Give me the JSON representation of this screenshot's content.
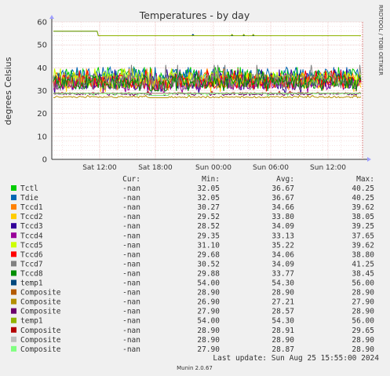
{
  "chart_data": {
    "type": "line",
    "title": "Temperatures - by day",
    "ylabel": "degrees Celsius",
    "side_label": "RRDTOOL / TOBI OETIKER",
    "ylim": [
      0,
      60
    ],
    "yticks": [
      0,
      10,
      20,
      30,
      40,
      50,
      60
    ],
    "xticks": [
      "Sat 12:00",
      "Sat 18:00",
      "Sun 00:00",
      "Sun 06:00",
      "Sun 12:00"
    ],
    "grid": true,
    "legend_header": {
      "cur": "Cur:",
      "min": "Min:",
      "avg": "Avg:",
      "max": "Max:"
    },
    "series": [
      {
        "name": "Tctl",
        "color": "#00cc00",
        "cur": "-nan",
        "min": "32.05",
        "avg": "36.67",
        "max": "40.25"
      },
      {
        "name": "Tdie",
        "color": "#0066b3",
        "cur": "-nan",
        "min": "32.05",
        "avg": "36.67",
        "max": "40.25"
      },
      {
        "name": "Tccd1",
        "color": "#ff8000",
        "cur": "-nan",
        "min": "30.27",
        "avg": "34.66",
        "max": "39.62"
      },
      {
        "name": "Tccd2",
        "color": "#ffcc00",
        "cur": "-nan",
        "min": "29.52",
        "avg": "33.80",
        "max": "38.05"
      },
      {
        "name": "Tccd3",
        "color": "#330099",
        "cur": "-nan",
        "min": "28.52",
        "avg": "34.09",
        "max": "39.25"
      },
      {
        "name": "Tccd4",
        "color": "#990099",
        "cur": "-nan",
        "min": "29.35",
        "avg": "33.13",
        "max": "37.65"
      },
      {
        "name": "Tccd5",
        "color": "#ccff00",
        "cur": "-nan",
        "min": "31.10",
        "avg": "35.22",
        "max": "39.62"
      },
      {
        "name": "Tccd6",
        "color": "#ff0000",
        "cur": "-nan",
        "min": "29.68",
        "avg": "34.06",
        "max": "38.80"
      },
      {
        "name": "Tccd7",
        "color": "#808080",
        "cur": "-nan",
        "min": "30.52",
        "avg": "34.09",
        "max": "41.25"
      },
      {
        "name": "Tccd8",
        "color": "#008f00",
        "cur": "-nan",
        "min": "29.88",
        "avg": "33.77",
        "max": "38.45"
      },
      {
        "name": "temp1",
        "color": "#00487d",
        "cur": "-nan",
        "min": "54.00",
        "avg": "54.30",
        "max": "56.00"
      },
      {
        "name": "Composite",
        "color": "#b35a00",
        "cur": "-nan",
        "min": "28.90",
        "avg": "28.90",
        "max": "28.90"
      },
      {
        "name": "Composite",
        "color": "#b38f00",
        "cur": "-nan",
        "min": "26.90",
        "avg": "27.21",
        "max": "27.90"
      },
      {
        "name": "Composite",
        "color": "#6b006b",
        "cur": "-nan",
        "min": "27.90",
        "avg": "28.57",
        "max": "28.90"
      },
      {
        "name": "temp1",
        "color": "#8fb300",
        "cur": "-nan",
        "min": "54.00",
        "avg": "54.30",
        "max": "56.00"
      },
      {
        "name": "Composite",
        "color": "#b30000",
        "cur": "-nan",
        "min": "28.90",
        "avg": "28.91",
        "max": "29.65"
      },
      {
        "name": "Composite",
        "color": "#bebebe",
        "cur": "-nan",
        "min": "28.90",
        "avg": "28.90",
        "max": "28.90"
      },
      {
        "name": "Composite",
        "color": "#80ff80",
        "cur": "-nan",
        "min": "27.90",
        "avg": "28.87",
        "max": "28.90"
      }
    ],
    "last_update": "Last update: Sun Aug 25 15:55:00 2024",
    "footer": "Munin 2.0.67"
  }
}
